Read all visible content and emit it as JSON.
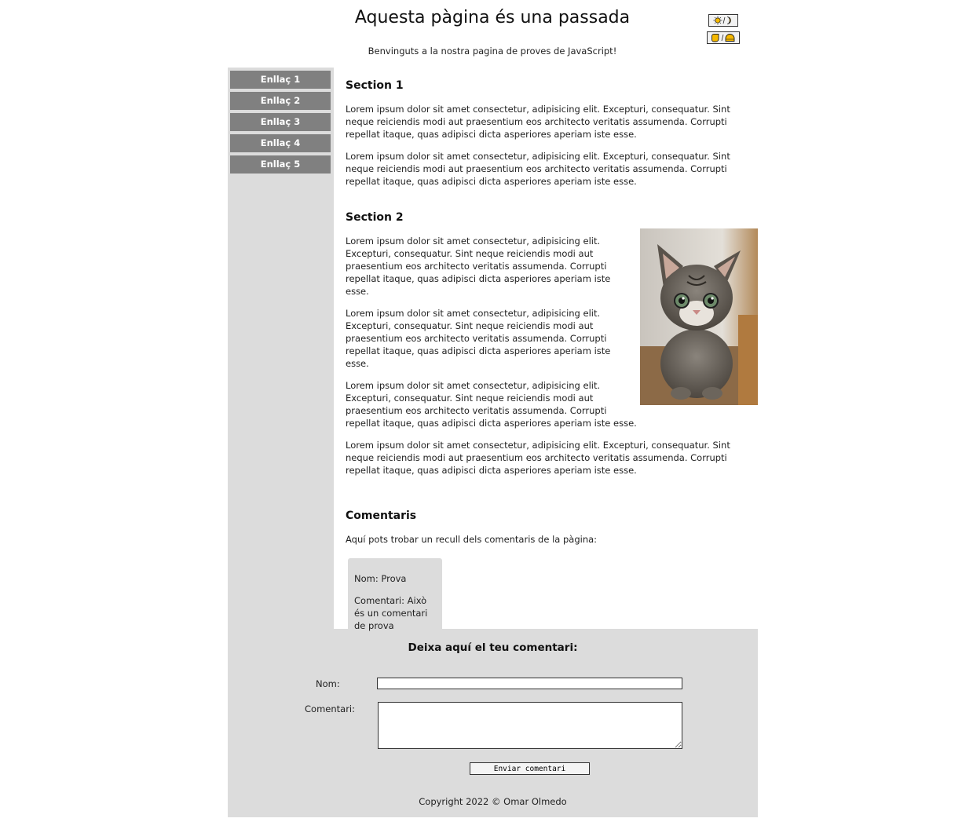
{
  "header": {
    "title": "Aquesta pàgina és una passada",
    "subtitle": "Benvinguts a la nostra pagina de proves de JavaScript!",
    "theme_toggle_icon": "sun-moon-icon",
    "style_toggle_icon": "shape-toggle-icon",
    "accent_color": "#f5b800"
  },
  "sidebar": {
    "links": [
      {
        "label": "Enllaç 1"
      },
      {
        "label": "Enllaç 2"
      },
      {
        "label": "Enllaç 3"
      },
      {
        "label": "Enllaç 4"
      },
      {
        "label": "Enllaç 5"
      }
    ],
    "link_color": "#808080",
    "background": "#dcdcdc"
  },
  "sections": {
    "s1": {
      "title": "Section 1",
      "paragraphs": [
        "Lorem ipsum dolor sit amet consectetur, adipisicing elit. Excepturi, consequatur. Sint neque reiciendis modi aut praesentium eos architecto veritatis assumenda. Corrupti repellat itaque, quas adipisci dicta asperiores aperiam iste esse.",
        "Lorem ipsum dolor sit amet consectetur, adipisicing elit. Excepturi, consequatur. Sint neque reiciendis modi aut praesentium eos architecto veritatis assumenda. Corrupti repellat itaque, quas adipisci dicta asperiores aperiam iste esse."
      ]
    },
    "s2": {
      "title": "Section 2",
      "image": "kitten-photo",
      "paragraphs": [
        "Lorem ipsum dolor sit amet consectetur, adipisicing elit. Excepturi, consequatur. Sint neque reiciendis modi aut praesentium eos architecto veritatis assumenda. Corrupti repellat itaque, quas adipisci dicta asperiores aperiam iste esse.",
        "Lorem ipsum dolor sit amet consectetur, adipisicing elit. Excepturi, consequatur. Sint neque reiciendis modi aut praesentium eos architecto veritatis assumenda. Corrupti repellat itaque, quas adipisci dicta asperiores aperiam iste esse.",
        "Lorem ipsum dolor sit amet consectetur, adipisicing elit. Excepturi, consequatur. Sint neque reiciendis modi aut praesentium eos architecto veritatis assumenda. Corrupti repellat itaque, quas adipisci dicta asperiores aperiam iste esse.",
        "Lorem ipsum dolor sit amet consectetur, adipisicing elit. Excepturi, consequatur. Sint neque reiciendis modi aut praesentium eos architecto veritatis assumenda. Corrupti repellat itaque, quas adipisci dicta asperiores aperiam iste esse."
      ]
    },
    "comments": {
      "title": "Comentaris",
      "intro": "Aquí pots trobar un recull dels comentaris de la pàgina:",
      "items": [
        {
          "name": "Nom: Prova",
          "text": "Comentari: Això és un comentari de prova"
        }
      ]
    }
  },
  "form": {
    "title": "Deixa aquí el teu comentari:",
    "name_label": "Nom:",
    "name_value": "",
    "comment_label": "Comentari:",
    "comment_value": "",
    "submit_label": "Enviar comentari"
  },
  "footer": {
    "copyright": "Copyright 2022 © Omar Olmedo"
  }
}
